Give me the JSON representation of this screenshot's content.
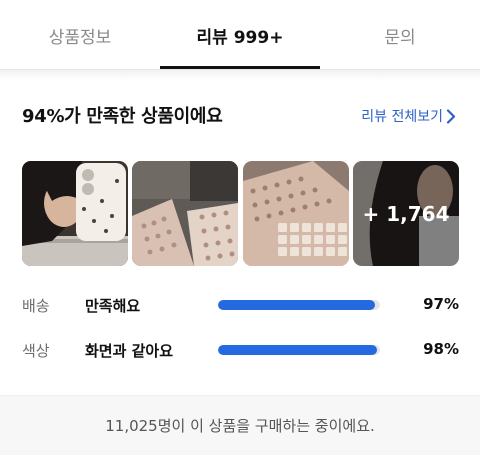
{
  "tabs": [
    {
      "label": "상품정보",
      "active": false
    },
    {
      "label": "리뷰 999+",
      "active": true
    },
    {
      "label": "문의",
      "active": false
    }
  ],
  "summary": {
    "headline": "94%가 만족한 상품이에요",
    "view_all_label": "리뷰 전체보기",
    "view_all_icon": "chevron-right-icon"
  },
  "photos": {
    "more_count_label": "+ 1,764"
  },
  "stats": [
    {
      "label": "배송",
      "value": "만족해요",
      "percent_label": "97%",
      "percent": 97
    },
    {
      "label": "색상",
      "value": "화면과 같아요",
      "percent_label": "98%",
      "percent": 98
    }
  ],
  "footer": {
    "text": "11,025명이 이 상품을 구매하는 중이에요."
  },
  "colors": {
    "accent": "#2469e0",
    "link": "#2f62c8"
  }
}
